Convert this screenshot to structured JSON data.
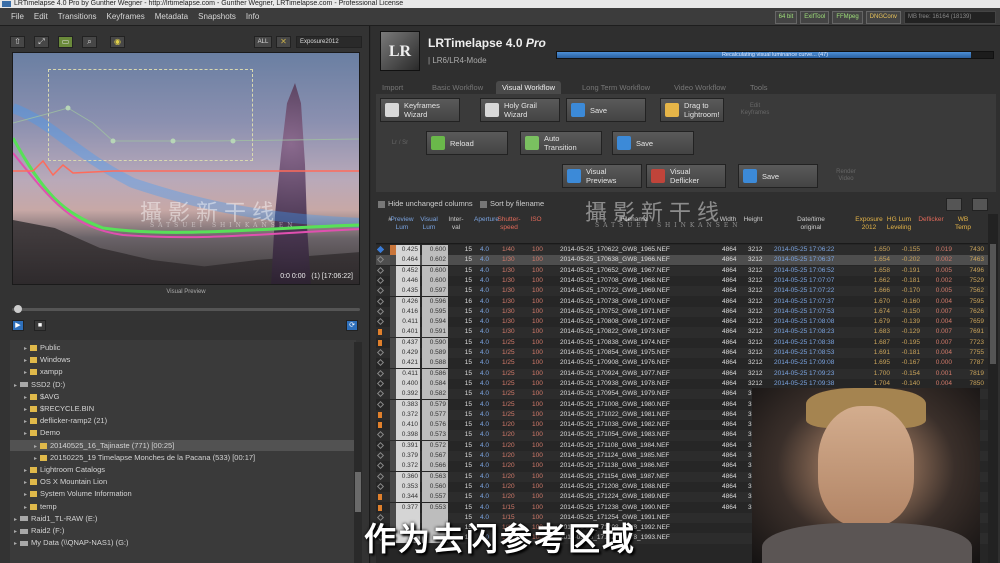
{
  "window": {
    "title": "LRTimelapse 4.0 Pro by Gunther Wegner - http://lrtimelapse.com - Gunther Wegner, LRTimelapse.com - Professional License"
  },
  "menu": [
    "File",
    "Edit",
    "Transitions",
    "Keyframes",
    "Metadata",
    "Snapshots",
    "Info"
  ],
  "status_chips": [
    {
      "label": "64 bit",
      "tone": "green"
    },
    {
      "label": "ExifTool",
      "tone": "green"
    },
    {
      "label": "FFMpeg",
      "tone": "green"
    },
    {
      "label": "DNGConv",
      "tone": "amber"
    },
    {
      "label": "MB free: 16164 (18139)",
      "tone": "mem"
    }
  ],
  "preview": {
    "toolbar": {
      "all_label": "ALL",
      "exposure_select": "Exposure2012"
    },
    "frame_info": "(1) [17:06:22]",
    "counter": "0:0 0:00",
    "label": "Visual Preview"
  },
  "tree": [
    {
      "label": "Public",
      "type": "folder",
      "indent": 1
    },
    {
      "label": "Windows",
      "type": "folder",
      "indent": 1
    },
    {
      "label": "xampp",
      "type": "folder",
      "indent": 1
    },
    {
      "label": "SSD2 (D:)",
      "type": "drive",
      "indent": 0
    },
    {
      "label": "$AVG",
      "type": "folder",
      "indent": 1
    },
    {
      "label": "$RECYCLE.BIN",
      "type": "folder",
      "indent": 1
    },
    {
      "label": "deflicker-ramp2 (21)",
      "type": "folder",
      "indent": 1
    },
    {
      "label": "Demo",
      "type": "folder",
      "indent": 1
    },
    {
      "label": "20140525_16_Tajinaste (771) [00:25]",
      "type": "folder",
      "indent": 2,
      "selected": true
    },
    {
      "label": "20150225_19 Timelapse Monches de la Pacana (533) [00:17]",
      "type": "folder",
      "indent": 2
    },
    {
      "label": "Lightroom Catalogs",
      "type": "folder",
      "indent": 1
    },
    {
      "label": "OS X Mountain Lion",
      "type": "folder",
      "indent": 1
    },
    {
      "label": "System Volume Information",
      "type": "folder",
      "indent": 1
    },
    {
      "label": "temp",
      "type": "folder",
      "indent": 1
    },
    {
      "label": "Raid1_TL-RAW (E:)",
      "type": "drive",
      "indent": 0
    },
    {
      "label": "Raid2 (F:)",
      "type": "drive",
      "indent": 0
    },
    {
      "label": "My Data (\\\\QNAP-NAS1) (G:)",
      "type": "drive",
      "indent": 0
    }
  ],
  "brand": {
    "logo": "LR",
    "name": "LRTimelapse 4.0",
    "edition": "Pro",
    "subtitle": "LR6/LR4-Mode"
  },
  "progress": {
    "text": "Recalculating visual luminance curve... (47)",
    "fraction": 0.95
  },
  "tabs": [
    {
      "label": "Import",
      "active": false
    },
    {
      "label": "Basic Workflow",
      "active": false
    },
    {
      "label": "Visual Workflow",
      "active": true
    },
    {
      "label": "Long Term Workflow",
      "active": false
    },
    {
      "label": "Video Workflow",
      "active": false
    },
    {
      "label": "Tools",
      "active": false
    }
  ],
  "workflow": {
    "row1": [
      {
        "label": "Keyframes\nWizard",
        "icon": "wand-icon",
        "color": "#d8d8d8"
      },
      {
        "label": "Holy Grail\nWizard",
        "icon": "wand-icon",
        "color": "#d8d8d8"
      },
      {
        "label": "Save",
        "icon": "save-icon",
        "color": "#3c8ad8"
      },
      {
        "label": "Drag to\nLightroom!",
        "icon": "arrow-icon",
        "color": "#e6b548"
      }
    ],
    "row1_side": "Edit\nKeyframes",
    "row2_side": "Lr / Sr",
    "row2": [
      {
        "label": "Reload",
        "icon": "reload-icon",
        "color": "#6ab84a"
      },
      {
        "label": "Auto\nTransition",
        "icon": "curve-icon",
        "color": "#7ac060"
      },
      {
        "label": "Save",
        "icon": "save-icon",
        "color": "#3c8ad8"
      }
    ],
    "row3": [
      {
        "label": "Visual\nPreviews",
        "icon": "target-icon",
        "color": "#3c8ad8"
      },
      {
        "label": "Visual\nDeflicker",
        "icon": "deflicker-icon",
        "color": "#c0443a"
      },
      {
        "label": "Save",
        "icon": "save-icon",
        "color": "#3c8ad8"
      }
    ],
    "row3_side": "Render\nVideo"
  },
  "table_toolbar": {
    "hide_unchanged": "Hide unchanged columns",
    "sort_by_filename": "Sort by filename"
  },
  "table": {
    "headers": [
      {
        "label": "#",
        "tone": "white"
      },
      {
        "label": "Preview\nLum",
        "tone": "blue"
      },
      {
        "label": "Visual\nLum",
        "tone": "blue"
      },
      {
        "label": "Inter-\nval",
        "tone": "white"
      },
      {
        "label": "Aperture",
        "tone": "blue"
      },
      {
        "label": "Shutter-\nspeed",
        "tone": "red"
      },
      {
        "label": "ISO",
        "tone": "red"
      },
      {
        "label": "Filename",
        "tone": "white"
      },
      {
        "label": "Width",
        "tone": "white"
      },
      {
        "label": "Height",
        "tone": "white"
      },
      {
        "label": "Date/time\noriginal",
        "tone": "white"
      },
      {
        "label": "Exposure\n2012",
        "tone": "amber"
      },
      {
        "label": "HG Lum\nLeveling",
        "tone": "amber"
      },
      {
        "label": "Deflicker",
        "tone": "red"
      },
      {
        "label": "WB\nTemp",
        "tone": "amber"
      }
    ],
    "rows": [
      [
        "1",
        "0.425",
        "0.600",
        "15",
        "4.0",
        "1/40",
        "100",
        "2014-05-25_170622_GW8_1965.NEF",
        "4864",
        "3212",
        "2014-05-25 17:06:22",
        "1.650",
        "-0.155",
        "0.019",
        "7430",
        "key"
      ],
      [
        "2",
        "0.464",
        "0.602",
        "15",
        "4.0",
        "1/30",
        "100",
        "2014-05-25_170638_GW8_1966.NEF",
        "4864",
        "3212",
        "2014-05-25 17:06:37",
        "1.654",
        "-0.202",
        "0.002",
        "7463",
        "sel"
      ],
      [
        "3",
        "0.452",
        "0.600",
        "15",
        "4.0",
        "1/30",
        "100",
        "2014-05-25_170652_GW8_1967.NEF",
        "4864",
        "3212",
        "2014-05-25 17:06:52",
        "1.658",
        "-0.191",
        "0.005",
        "7496",
        ""
      ],
      [
        "4",
        "0.446",
        "0.600",
        "15",
        "4.0",
        "1/30",
        "100",
        "2014-05-25_170708_GW8_1968.NEF",
        "4864",
        "3212",
        "2014-05-25 17:07:07",
        "1.662",
        "-0.181",
        "0.002",
        "7529",
        ""
      ],
      [
        "5",
        "0.435",
        "0.597",
        "15",
        "4.0",
        "1/30",
        "100",
        "2014-05-25_170722_GW8_1969.NEF",
        "4864",
        "3212",
        "2014-05-25 17:07:22",
        "1.666",
        "-0.170",
        "0.005",
        "7562",
        ""
      ],
      [
        "6",
        "0.426",
        "0.596",
        "16",
        "4.0",
        "1/30",
        "100",
        "2014-05-25_170738_GW8_1970.NEF",
        "4864",
        "3212",
        "2014-05-25 17:07:37",
        "1.670",
        "-0.160",
        "0.004",
        "7595",
        ""
      ],
      [
        "7",
        "0.416",
        "0.595",
        "15",
        "4.0",
        "1/30",
        "100",
        "2014-05-25_170752_GW8_1971.NEF",
        "4864",
        "3212",
        "2014-05-25 17:07:53",
        "1.674",
        "-0.150",
        "0.007",
        "7626",
        ""
      ],
      [
        "8",
        "0.411",
        "0.594",
        "15",
        "4.0",
        "1/30",
        "100",
        "2014-05-25_170808_GW8_1972.NEF",
        "4864",
        "3212",
        "2014-05-25 17:08:08",
        "1.679",
        "-0.139",
        "0.004",
        "7659",
        ""
      ],
      [
        "9",
        "0.401",
        "0.591",
        "15",
        "4.0",
        "1/30",
        "100",
        "2014-05-25_170822_GW8_1973.NEF",
        "4864",
        "3212",
        "2014-05-25 17:08:23",
        "1.683",
        "-0.129",
        "0.007",
        "7691",
        "orange"
      ],
      [
        "10",
        "0.437",
        "0.590",
        "15",
        "4.0",
        "1/25",
        "100",
        "2014-05-25_170838_GW8_1974.NEF",
        "4864",
        "3212",
        "2014-05-25 17:08:38",
        "1.687",
        "-0.195",
        "0.007",
        "7723",
        "orange"
      ],
      [
        "11",
        "0.429",
        "0.589",
        "15",
        "4.0",
        "1/25",
        "100",
        "2014-05-25_170854_GW8_1975.NEF",
        "4864",
        "3212",
        "2014-05-25 17:08:53",
        "1.691",
        "-0.181",
        "0.004",
        "7755",
        ""
      ],
      [
        "12",
        "0.421",
        "0.588",
        "15",
        "4.0",
        "1/25",
        "100",
        "2014-05-25_170908_GW8_1976.NEF",
        "4864",
        "3212",
        "2014-05-25 17:09:08",
        "1.695",
        "-0.167",
        "0.000",
        "7787",
        ""
      ],
      [
        "13",
        "0.411",
        "0.586",
        "15",
        "4.0",
        "1/25",
        "100",
        "2014-05-25_170924_GW8_1977.NEF",
        "4864",
        "3212",
        "2014-05-25 17:09:23",
        "1.700",
        "-0.154",
        "0.001",
        "7819",
        ""
      ],
      [
        "14",
        "0.400",
        "0.584",
        "15",
        "4.0",
        "1/25",
        "100",
        "2014-05-25_170938_GW8_1978.NEF",
        "4864",
        "3212",
        "2014-05-25 17:09:38",
        "1.704",
        "-0.140",
        "0.004",
        "7850",
        ""
      ],
      [
        "15",
        "0.392",
        "0.582",
        "15",
        "4.0",
        "1/25",
        "100",
        "2014-05-25_170954_GW8_1979.NEF",
        "4864",
        "32",
        "",
        "",
        "",
        "",
        "",
        ""
      ],
      [
        "16",
        "0.383",
        "0.579",
        "15",
        "4.0",
        "1/25",
        "100",
        "2014-05-25_171008_GW8_1980.NEF",
        "4864",
        "32",
        "",
        "",
        "",
        "",
        "",
        ""
      ],
      [
        "17",
        "0.372",
        "0.577",
        "15",
        "4.0",
        "1/25",
        "100",
        "2014-05-25_171022_GW8_1981.NEF",
        "4864",
        "32",
        "",
        "",
        "",
        "",
        "",
        "orange"
      ],
      [
        "18",
        "0.410",
        "0.576",
        "15",
        "4.0",
        "1/20",
        "100",
        "2014-05-25_171038_GW8_1982.NEF",
        "4864",
        "32",
        "",
        "",
        "",
        "",
        "",
        "orange"
      ],
      [
        "19",
        "0.398",
        "0.573",
        "15",
        "4.0",
        "1/20",
        "100",
        "2014-05-25_171054_GW8_1983.NEF",
        "4864",
        "32",
        "",
        "",
        "",
        "",
        "",
        ""
      ],
      [
        "20",
        "0.391",
        "0.572",
        "15",
        "4.0",
        "1/20",
        "100",
        "2014-05-25_171108_GW8_1984.NEF",
        "4864",
        "32",
        "",
        "",
        "",
        "",
        "",
        ""
      ],
      [
        "21",
        "0.379",
        "0.567",
        "15",
        "4.0",
        "1/20",
        "100",
        "2014-05-25_171124_GW8_1985.NEF",
        "4864",
        "32",
        "",
        "",
        "",
        "",
        "",
        ""
      ],
      [
        "22",
        "0.372",
        "0.566",
        "15",
        "4.0",
        "1/20",
        "100",
        "2014-05-25_171138_GW8_1986.NEF",
        "4864",
        "32",
        "",
        "",
        "",
        "",
        "",
        ""
      ],
      [
        "23",
        "0.360",
        "0.563",
        "15",
        "4.0",
        "1/20",
        "100",
        "2014-05-25_171154_GW8_1987.NEF",
        "4864",
        "32",
        "",
        "",
        "",
        "",
        "",
        ""
      ],
      [
        "24",
        "0.353",
        "0.560",
        "15",
        "4.0",
        "1/20",
        "100",
        "2014-05-25_171208_GW8_1988.NEF",
        "4864",
        "32",
        "",
        "",
        "",
        "",
        "",
        ""
      ],
      [
        "25",
        "0.344",
        "0.557",
        "15",
        "4.0",
        "1/20",
        "100",
        "2014-05-25_171224_GW8_1989.NEF",
        "4864",
        "32",
        "",
        "",
        "",
        "",
        "",
        "orange"
      ],
      [
        "26",
        "0.377",
        "0.553",
        "15",
        "4.0",
        "1/15",
        "100",
        "2014-05-25_171238_GW8_1990.NEF",
        "4864",
        "32",
        "",
        "",
        "",
        "",
        "",
        "orange"
      ],
      [
        "27",
        "",
        "",
        "15",
        "4.0",
        "1/15",
        "100",
        "2014-05-25_171254_GW8_1991.NEF",
        "",
        "",
        "",
        "",
        "",
        "",
        "",
        ""
      ],
      [
        "28",
        "",
        "",
        "15",
        "4.0",
        "1/15",
        "100",
        "2014-05-25_171308_GW8_1992.NEF",
        "",
        "",
        "",
        "",
        "",
        "",
        "",
        ""
      ],
      [
        "29",
        "",
        "",
        "15",
        "4.0",
        "1/15",
        "100",
        "2014-05-25_171324_GW8_1993.NEF",
        "",
        "",
        "",
        "",
        "",
        "",
        "",
        ""
      ]
    ]
  },
  "watermark": {
    "cn": "攝影新干线",
    "en": "SATSUEI SHINKANSEN"
  },
  "subtitle": "作为去闪参考区域"
}
